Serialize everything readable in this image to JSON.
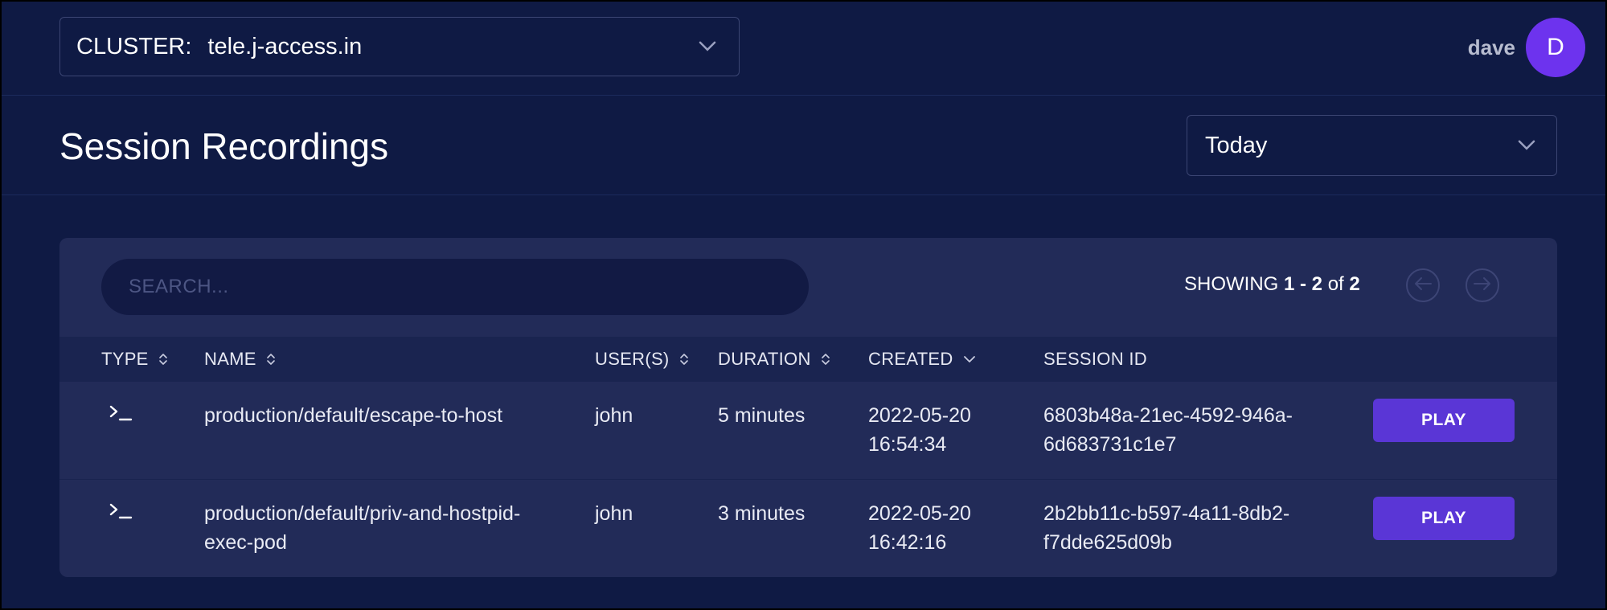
{
  "topbar": {
    "cluster_label": "CLUSTER:",
    "cluster_value": "tele.j-access.in",
    "user_name": "dave",
    "avatar_initial": "D"
  },
  "header": {
    "title": "Session Recordings",
    "range_value": "Today"
  },
  "toolbar": {
    "search_placeholder": "SEARCH...",
    "showing_prefix": "SHOWING",
    "showing_range": "1 - 2",
    "showing_of": "of",
    "showing_total": "2"
  },
  "table": {
    "columns": [
      {
        "label": "TYPE",
        "sort": "both"
      },
      {
        "label": "NAME",
        "sort": "both"
      },
      {
        "label": "USER(S)",
        "sort": "both"
      },
      {
        "label": "DURATION",
        "sort": "both"
      },
      {
        "label": "CREATED",
        "sort": "desc"
      },
      {
        "label": "SESSION ID",
        "sort": "none"
      }
    ],
    "rows": [
      {
        "type_icon": "terminal-icon",
        "name_line1": "production/default/escape-to-host",
        "name_line2": "",
        "user": "john",
        "duration": "5 minutes",
        "created_date": "2022-05-20",
        "created_time": "16:54:34",
        "session_id_line1": "6803b48a-21ec-4592-946a-",
        "session_id_line2": "6d683731c1e7",
        "action": "PLAY"
      },
      {
        "type_icon": "terminal-icon",
        "name_line1": "production/default/priv-and-hostpid-",
        "name_line2": "exec-pod",
        "user": "john",
        "duration": "3 minutes",
        "created_date": "2022-05-20",
        "created_time": "16:42:16",
        "session_id_line1": "2b2bb11c-b597-4a11-8db2-",
        "session_id_line2": "f7dde625d09b",
        "action": "PLAY"
      }
    ]
  },
  "colors": {
    "background": "#0f1a44",
    "card": "#222b58",
    "accent": "#5a36d6",
    "avatar": "#6d33ee"
  }
}
